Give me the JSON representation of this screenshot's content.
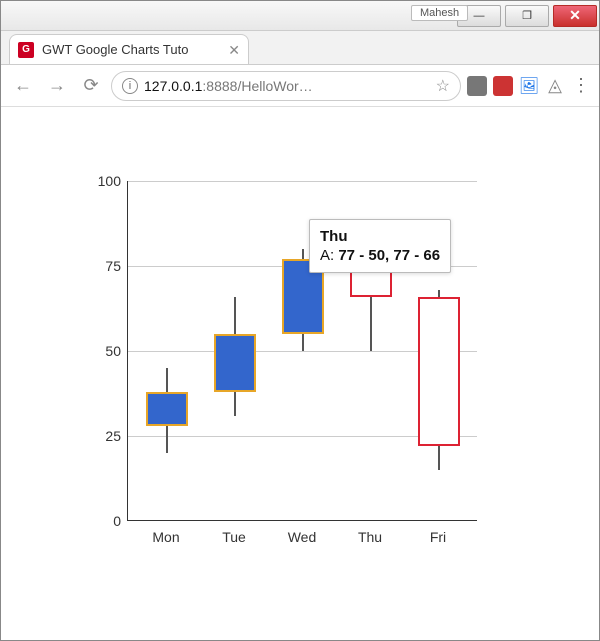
{
  "window": {
    "user_label": "Mahesh",
    "min_label": "—",
    "max_label": "❐",
    "close_label": "✕"
  },
  "tab": {
    "title": "GWT Google Charts Tuto",
    "close": "✕",
    "favicon_letter": "G"
  },
  "nav": {
    "back": "←",
    "fwd": "→",
    "reload": "⟳"
  },
  "omnibox": {
    "info": "i",
    "host": "127.0.0.1",
    "port": ":8888",
    "path": "/HelloWor…",
    "star": "☆"
  },
  "toolbar_icons": {
    "square": "",
    "book": "",
    "pic": "🖼",
    "drive": "◬",
    "menu": "⋮"
  },
  "chart_data": {
    "type": "candlestick",
    "ylim": [
      0,
      100
    ],
    "yticks": [
      0,
      25,
      50,
      75,
      100
    ],
    "categories": [
      "Mon",
      "Tue",
      "Wed",
      "Thu",
      "Fri"
    ],
    "series_name": "A",
    "series": [
      {
        "cat": "Mon",
        "low": 20,
        "open": 28,
        "close": 38,
        "high": 45,
        "rising": true
      },
      {
        "cat": "Tue",
        "low": 31,
        "open": 38,
        "close": 55,
        "high": 66,
        "rising": true
      },
      {
        "cat": "Wed",
        "low": 50,
        "open": 55,
        "close": 77,
        "high": 80,
        "rising": true
      },
      {
        "cat": "Thu",
        "low": 50,
        "open": 77,
        "close": 66,
        "high": 77,
        "rising": false
      },
      {
        "cat": "Fri",
        "low": 15,
        "open": 66,
        "close": 22,
        "high": 68,
        "rising": false
      }
    ],
    "tooltip": {
      "category": "Thu",
      "prefix": "A: ",
      "values_text": "77 - 50, 77 - 66"
    }
  }
}
